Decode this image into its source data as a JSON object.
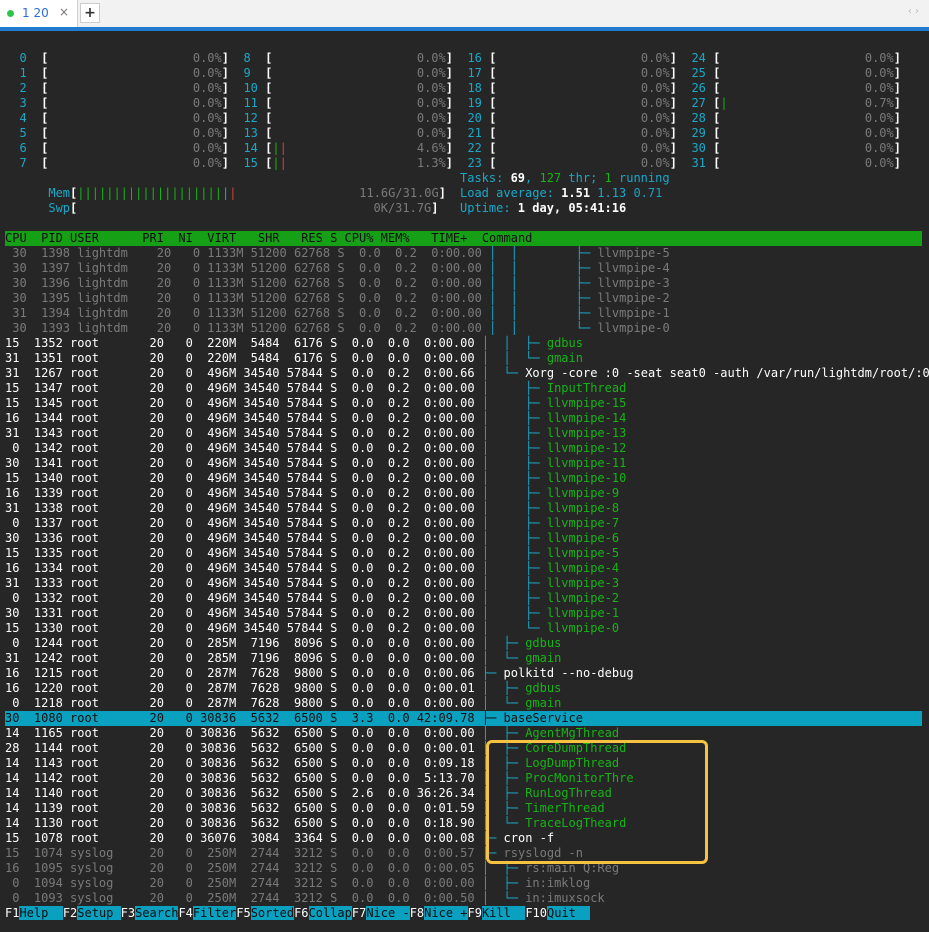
{
  "tab": {
    "label": "1 20",
    "close": "×",
    "new": "+",
    "arrows": "‹ ›"
  },
  "cpu_rows": [
    [
      "  0  [                    0.0%]",
      "  8  [                    0.0%]",
      "  16 [                    0.0%]",
      "  24 [                    0.0%]"
    ],
    [
      "  1  [                    0.0%]",
      "  9  [                    0.0%]",
      "  17 [                    0.0%]",
      "  25 [                    0.0%]"
    ],
    [
      "  2  [                    0.0%]",
      "  10 [                    0.0%]",
      "  18 [                    0.0%]",
      "  26 [                    0.0%]"
    ],
    [
      "  3  [                    0.0%]",
      "  11 [                    0.0%]",
      "  19 [                    0.0%]",
      "  27 [|                   0.7%]"
    ],
    [
      "  4  [                    0.0%]",
      "  12 [                    0.0%]",
      "  20 [                    0.0%]",
      "  28 [                    0.0%]"
    ],
    [
      "  5  [                    0.0%]",
      "  13 [                    0.0%]",
      "  21 [                    0.0%]",
      "  29 [                    0.0%]"
    ],
    [
      "  6  [                    0.0%]",
      "  14 [||                  4.6%]",
      "  22 [                    0.0%]",
      "  30 [                    0.0%]"
    ],
    [
      "  7  [                    0.0%]",
      "  15 [||                  1.3%]",
      "  23 [                    0.0%]",
      "  31 [                    0.0%]"
    ]
  ],
  "mem": "  Mem[||||||||||||||||||||||                 11.6G/31.0G]",
  "swp": "  Swp[                                         0K/31.7G]",
  "tasks": {
    "label": "Tasks: ",
    "count": "69",
    "sep": ", ",
    "threads": "127",
    "thr": " thr; ",
    "running": "1",
    "running_label": " running"
  },
  "load": {
    "label": "Load average: ",
    "l1": "1.51",
    "l5": "1.13",
    "l15": "0.71"
  },
  "uptime": {
    "label": "Uptime: ",
    "value": "1 day, 05:41:16"
  },
  "header": "CPU  PID USER      PRI  NI  VIRT   SHR   RES S CPU% MEM%   TIME+  Command",
  "processes": [
    [
      " 30  1398 lightdm    20   0 1133M 51200 62768 S  0.0  0.2  0:00.00 ",
      "│  │        ├─ llvmpipe-5"
    ],
    [
      " 30  1397 lightdm    20   0 1133M 51200 62768 S  0.0  0.2  0:00.00 ",
      "│  │        ├─ llvmpipe-4"
    ],
    [
      " 30  1396 lightdm    20   0 1133M 51200 62768 S  0.0  0.2  0:00.00 ",
      "│  │        ├─ llvmpipe-3"
    ],
    [
      " 30  1395 lightdm    20   0 1133M 51200 62768 S  0.0  0.2  0:00.00 ",
      "│  │        ├─ llvmpipe-2"
    ],
    [
      " 31  1394 lightdm    20   0 1133M 51200 62768 S  0.0  0.2  0:00.00 ",
      "│  │        ├─ llvmpipe-1"
    ],
    [
      " 30  1393 lightdm    20   0 1133M 51200 62768 S  0.0  0.2  0:00.00 ",
      "│  │        └─ llvmpipe-0"
    ],
    [
      "15  1352 root       20   0  220M  5484  6176 S  0.0  0.0  0:00.00 ",
      "│  │  ├─ gdbus"
    ],
    [
      "31  1351 root       20   0  220M  5484  6176 S  0.0  0.0  0:00.00 ",
      "│  │  └─ gmain"
    ],
    [
      "31  1267 root       20   0  496M 34540 57844 S  0.0  0.2  0:00.66 ",
      "│  └─ Xorg -core :0 -seat seat0 -auth /var/run/lightdm/root/:0"
    ],
    [
      "15  1347 root       20   0  496M 34540 57844 S  0.0  0.2  0:00.00 ",
      "│     ├─ InputThread"
    ],
    [
      "15  1345 root       20   0  496M 34540 57844 S  0.0  0.2  0:00.00 ",
      "│     ├─ llvmpipe-15"
    ],
    [
      "16  1344 root       20   0  496M 34540 57844 S  0.0  0.2  0:00.00 ",
      "│     ├─ llvmpipe-14"
    ],
    [
      "31  1343 root       20   0  496M 34540 57844 S  0.0  0.2  0:00.00 ",
      "│     ├─ llvmpipe-13"
    ],
    [
      " 0  1342 root       20   0  496M 34540 57844 S  0.0  0.2  0:00.00 ",
      "│     ├─ llvmpipe-12"
    ],
    [
      "30  1341 root       20   0  496M 34540 57844 S  0.0  0.2  0:00.00 ",
      "│     ├─ llvmpipe-11"
    ],
    [
      "15  1340 root       20   0  496M 34540 57844 S  0.0  0.2  0:00.00 ",
      "│     ├─ llvmpipe-10"
    ],
    [
      "16  1339 root       20   0  496M 34540 57844 S  0.0  0.2  0:00.00 ",
      "│     ├─ llvmpipe-9"
    ],
    [
      "31  1338 root       20   0  496M 34540 57844 S  0.0  0.2  0:00.00 ",
      "│     ├─ llvmpipe-8"
    ],
    [
      " 0  1337 root       20   0  496M 34540 57844 S  0.0  0.2  0:00.00 ",
      "│     ├─ llvmpipe-7"
    ],
    [
      "30  1336 root       20   0  496M 34540 57844 S  0.0  0.2  0:00.00 ",
      "│     ├─ llvmpipe-6"
    ],
    [
      "15  1335 root       20   0  496M 34540 57844 S  0.0  0.2  0:00.00 ",
      "│     ├─ llvmpipe-5"
    ],
    [
      "16  1334 root       20   0  496M 34540 57844 S  0.0  0.2  0:00.00 ",
      "│     ├─ llvmpipe-4"
    ],
    [
      "31  1333 root       20   0  496M 34540 57844 S  0.0  0.2  0:00.00 ",
      "│     ├─ llvmpipe-3"
    ],
    [
      " 0  1332 root       20   0  496M 34540 57844 S  0.0  0.2  0:00.00 ",
      "│     ├─ llvmpipe-2"
    ],
    [
      "30  1331 root       20   0  496M 34540 57844 S  0.0  0.2  0:00.00 ",
      "│     ├─ llvmpipe-1"
    ],
    [
      "15  1330 root       20   0  496M 34540 57844 S  0.0  0.2  0:00.00 ",
      "│     └─ llvmpipe-0"
    ],
    [
      " 0  1244 root       20   0  285M  7196  8096 S  0.0  0.0  0:00.00 ",
      "│  ├─ gdbus"
    ],
    [
      "31  1242 root       20   0  285M  7196  8096 S  0.0  0.0  0:00.00 ",
      "│  └─ gmain"
    ],
    [
      "16  1215 root       20   0  287M  7628  9800 S  0.0  0.0  0:00.06 ",
      "├─ polkitd --no-debug"
    ],
    [
      "16  1220 root       20   0  287M  7628  9800 S  0.0  0.0  0:00.01 ",
      "│  ├─ gdbus"
    ],
    [
      " 0  1218 root       20   0  287M  7628  9800 S  0.0  0.0  0:00.00 ",
      "│  └─ gmain"
    ],
    [
      "30  1080 root       20   0 30836  5632  6500 S  3.3  0.0 42:09.78 ",
      "├─ baseService"
    ],
    [
      "14  1165 root       20   0 30836  5632  6500 S  0.0  0.0  0:00.00 ",
      "│  ├─ AgentMgThread"
    ],
    [
      "28  1144 root       20   0 30836  5632  6500 S  0.0  0.0  0:00.01 ",
      "│  ├─ CoreDumpThread"
    ],
    [
      "14  1143 root       20   0 30836  5632  6500 S  0.0  0.0  0:09.18 ",
      "│  ├─ LogDumpThread"
    ],
    [
      "14  1142 root       20   0 30836  5632  6500 S  0.0  0.0  5:13.70 ",
      "│  ├─ ProcMonitorThre"
    ],
    [
      "14  1140 root       20   0 30836  5632  6500 S  2.6  0.0 36:26.34 ",
      "│  ├─ RunLogThread"
    ],
    [
      "14  1139 root       20   0 30836  5632  6500 S  0.0  0.0  0:01.59 ",
      "│  ├─ TimerThread"
    ],
    [
      "14  1130 root       20   0 30836  5632  6500 S  0.0  0.0  0:18.90 ",
      "│  └─ TraceLogTheard"
    ],
    [
      "15  1078 root       20   0 36076  3084  3364 S  0.0  0.0  0:00.08 ",
      "├─ cron -f"
    ],
    [
      "15  1074 syslog     20   0  250M  2744  3212 S  0.0  0.0  0:00.57 ",
      "├─ rsyslogd -n"
    ],
    [
      "16  1095 syslog     20   0  250M  2744  3212 S  0.0  0.0  0:00.05 ",
      "│  ├─ rs:main Q:Reg"
    ],
    [
      " 0  1094 syslog     20   0  250M  2744  3212 S  0.0  0.0  0:00.00 ",
      "│  ├─ in:imklog"
    ],
    [
      " 0  1093 syslog     20   0  250M  2744  3212 S  0.0  0.0  0:00.50 ",
      "│  └─ in:imuxsock"
    ]
  ],
  "fkeys": [
    {
      "key": "F1",
      "label": "Help  "
    },
    {
      "key": "F2",
      "label": "Setup "
    },
    {
      "key": "F3",
      "label": "Search"
    },
    {
      "key": "F4",
      "label": "Filter"
    },
    {
      "key": "F5",
      "label": "Sorted"
    },
    {
      "key": "F6",
      "label": "Collap"
    },
    {
      "key": "F7",
      "label": "Nice -"
    },
    {
      "key": "F8",
      "label": "Nice +"
    },
    {
      "key": "F9",
      "label": "Kill  "
    },
    {
      "key": "F10",
      "label": "Quit  "
    }
  ],
  "colors": {
    "accent": "#1f7cd0",
    "header_bg": "#16a016",
    "selected_bg": "#0aa0c0",
    "annotation": "#f5c242",
    "thread_green": "#17b317",
    "cyan": "#1ba8c8"
  }
}
